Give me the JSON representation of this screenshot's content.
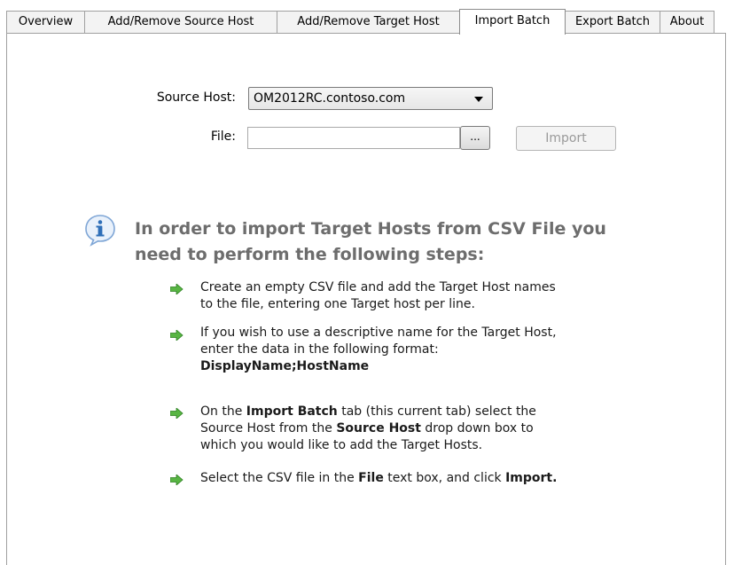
{
  "tabs": [
    {
      "label": "Overview",
      "active": false
    },
    {
      "label": "Add/Remove Source Host",
      "active": false
    },
    {
      "label": "Add/Remove Target Host",
      "active": false
    },
    {
      "label": "Import Batch",
      "active": true
    },
    {
      "label": "Export Batch",
      "active": false
    },
    {
      "label": "About",
      "active": false
    }
  ],
  "form": {
    "source_host_label": "Source Host:",
    "source_host_value": "OM2012RC.contoso.com",
    "file_label": "File:",
    "file_value": "",
    "browse_label": "...",
    "import_label": "Import",
    "import_enabled": false
  },
  "instructions": {
    "heading_line1": "In order to import Target Hosts from CSV File you",
    "heading_line2": "need to perform the following steps:",
    "step1_line1": "Create an empty CSV file and add the Target Host names",
    "step1_line2": "to the file, entering one Target host per line.",
    "step2_line1": "If you wish to use a descriptive name for the Target Host,",
    "step2_line2": "enter the data in the following format:",
    "step2_line3": "DisplayName;HostName",
    "step3_pre": "On the ",
    "step3_b1": "Import Batch",
    "step3_mid1": " tab (this current tab) select the",
    "step3_line2_pre": "Source Host from the ",
    "step3_b2": "Source Host",
    "step3_line2_post": " drop down box to",
    "step3_line3": "which you would like to add the Target Hosts.",
    "step4_pre": "Select the CSV file in the ",
    "step4_b1": "File",
    "step4_mid": " text box, and click ",
    "step4_b2": "Import."
  },
  "icons": {
    "info": "info-icon",
    "step_bullet": "green-arrow-icon"
  },
  "colors": {
    "heading": "#6d6d6d",
    "bullet_green": "#3a9a2a",
    "info_blue": "#2f6fb8"
  }
}
